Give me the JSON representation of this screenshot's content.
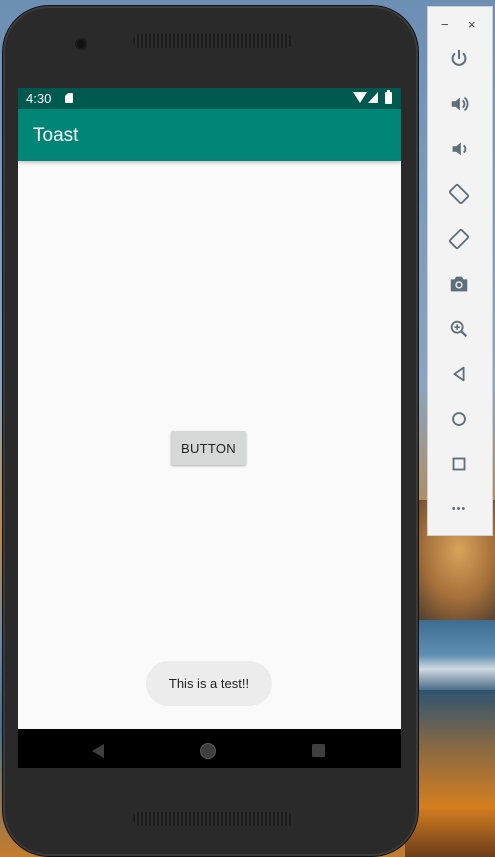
{
  "status_bar": {
    "time": "4:30"
  },
  "app_bar": {
    "title": "Toast"
  },
  "main": {
    "button_label": "BUTTON",
    "toast_message": "This is a test!!"
  },
  "emulator_panel": {
    "window_controls": {
      "minimize": "−",
      "close": "×"
    },
    "tools": [
      "power-icon",
      "volume-up-icon",
      "volume-down-icon",
      "rotate-left-icon",
      "rotate-right-icon",
      "screenshot-icon",
      "zoom-icon",
      "back-icon",
      "home-icon",
      "overview-icon",
      "more-icon"
    ],
    "more_label": "•••"
  },
  "colors": {
    "app_bar": "#008577",
    "status_bar": "#00594f",
    "screen_bg": "#fafafa",
    "nav_bar": "#000000"
  }
}
